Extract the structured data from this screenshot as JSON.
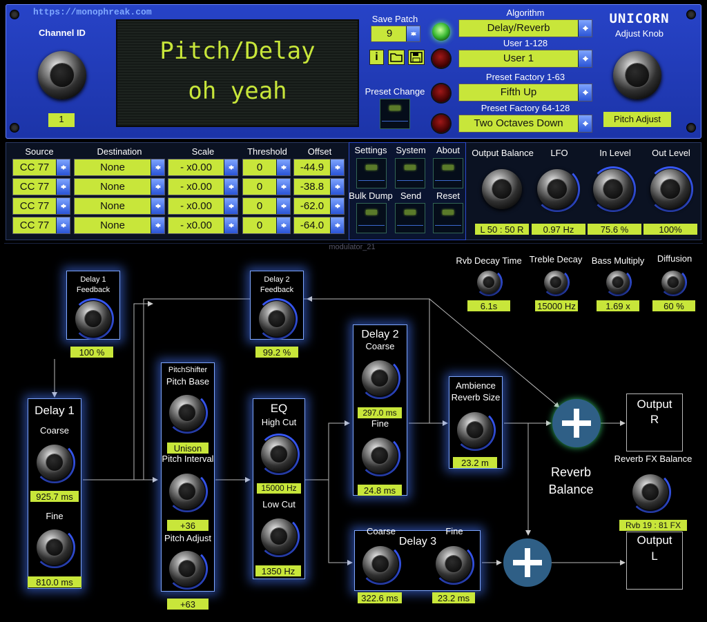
{
  "header": {
    "url": "https://monophreak.com",
    "brand": "UNICORN",
    "channel_label": "Channel ID",
    "channel_value": "1",
    "display_line1": "Pitch/Delay",
    "display_line2": "oh yeah",
    "save_patch_label": "Save Patch",
    "save_patch_value": "9",
    "preset_change_label": "Preset Change",
    "algorithm_label": "Algorithm",
    "algorithm_value": "Delay/Reverb",
    "user_label": "User 1-128",
    "user_value": "User 1",
    "factory1_label": "Preset Factory 1-63",
    "factory1_value": "Fifth Up",
    "factory2_label": "Preset Factory 64-128",
    "factory2_value": "Two Octaves Down",
    "adjust_knob_label": "Adjust Knob",
    "adjust_value": "Pitch Adjust",
    "icons": [
      "info-icon",
      "folder-icon",
      "save-icon"
    ]
  },
  "mod": {
    "headers": {
      "source": "Source",
      "destination": "Destination",
      "scale": "Scale",
      "threshold": "Threshold",
      "offset": "Offset"
    },
    "rows": [
      {
        "source": "CC 77",
        "destination": "None",
        "scale": "- x0.00",
        "threshold": "0",
        "offset": "-44.9"
      },
      {
        "source": "CC 77",
        "destination": "None",
        "scale": "- x0.00",
        "threshold": "0",
        "offset": "-38.8"
      },
      {
        "source": "CC 77",
        "destination": "None",
        "scale": "- x0.00",
        "threshold": "0",
        "offset": "-62.0"
      },
      {
        "source": "CC 77",
        "destination": "None",
        "scale": "- x0.00",
        "threshold": "0",
        "offset": "-64.0"
      }
    ]
  },
  "buttons": {
    "settings": "Settings",
    "system": "System",
    "about": "About",
    "bulk": "Bulk Dump",
    "send": "Send",
    "reset": "Reset"
  },
  "mix": {
    "output_balance": {
      "label": "Output Balance",
      "value": "L 50 : 50 R"
    },
    "lfo": {
      "label": "LFO",
      "value": "0.97 Hz"
    },
    "in_level": {
      "label": "In Level",
      "value": "75.6 %"
    },
    "out_level": {
      "label": "Out Level",
      "value": "100%"
    }
  },
  "reverb": {
    "decay": {
      "label": "Rvb Decay Time",
      "value": "6.1s"
    },
    "treble": {
      "label": "Treble Decay",
      "value": "15000 Hz"
    },
    "bass": {
      "label": "Bass Multiply",
      "value": "1.69 x"
    },
    "diffusion": {
      "label": "Diffusion",
      "value": "60 %"
    }
  },
  "flow": {
    "d1fb": {
      "title1": "Delay 1",
      "title2": "Feedback",
      "value": "100 %"
    },
    "d2fb": {
      "title1": "Delay 2",
      "title2": "Feedback",
      "value": "99.2 %"
    },
    "delay1": {
      "title": "Delay 1",
      "coarse": "Coarse",
      "coarse_value": "925.7 ms",
      "fine": "Fine",
      "fine_value": "810.0 ms"
    },
    "pitch": {
      "title": "PitchShifter",
      "base": "Pitch Base",
      "base_value": "Unison",
      "interval": "Pitch Interval",
      "interval_value": "+36",
      "adjust": "Pitch Adjust",
      "adjust_value": "+63"
    },
    "eq": {
      "title": "EQ",
      "high": "High Cut",
      "high_value": "15000 Hz",
      "low": "Low Cut",
      "low_value": "1350 Hz"
    },
    "delay2": {
      "title": "Delay 2",
      "coarse": "Coarse",
      "coarse_value": "297.0 ms",
      "fine": "Fine",
      "fine_value": "24.8 ms"
    },
    "ambience": {
      "title1": "Ambience",
      "title2": "Reverb Size",
      "value": "23.2 m"
    },
    "delay3": {
      "title": "Delay 3",
      "coarse": "Coarse",
      "coarse_value": "322.6 ms",
      "fine": "Fine",
      "fine_value": "23.2 ms"
    },
    "output_r": {
      "t1": "Output",
      "t2": "R"
    },
    "output_l": {
      "t1": "Output",
      "t2": "L"
    },
    "reverb_balance": {
      "t1": "Reverb",
      "t2": "Balance"
    },
    "fx_balance": {
      "label": "Reverb FX Balance",
      "value": "Rvb  19 : 81  FX"
    },
    "panel_name": "modulator_21"
  }
}
